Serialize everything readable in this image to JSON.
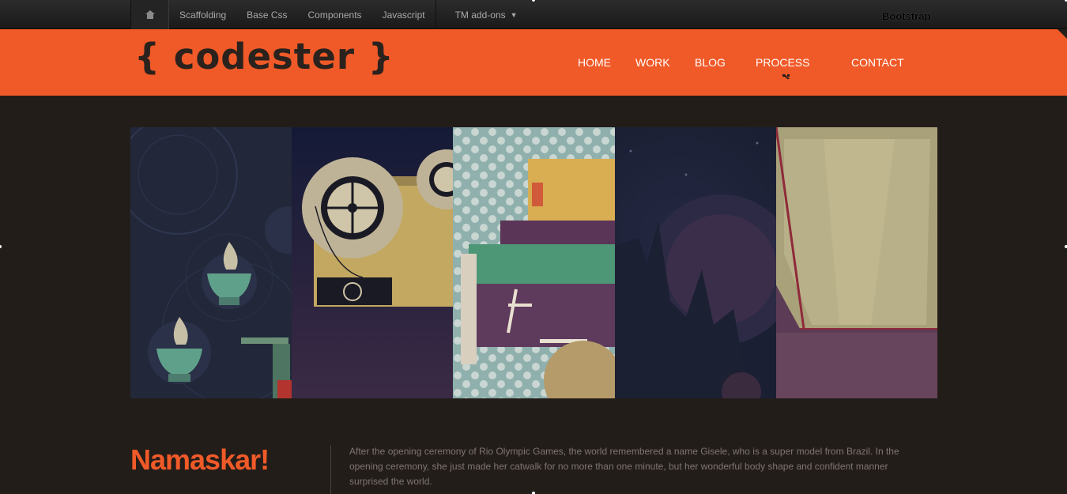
{
  "topbar": {
    "home_icon": "home-icon",
    "links": [
      "Scaffolding",
      "Base Css",
      "Components",
      "Javascript"
    ],
    "dropdown_label": "TM add-ons",
    "dropdown_caret": "▼",
    "brand": "Bootstrap"
  },
  "header": {
    "logo": "{ codester }",
    "nav": [
      "HOME",
      "WORK",
      "BLOG",
      "PROCESS",
      "CONTACT"
    ],
    "accent": "#f05a28"
  },
  "hero": {
    "panels": [
      "illustration-panel-1",
      "illustration-panel-2",
      "illustration-panel-3",
      "illustration-panel-4",
      "illustration-panel-5"
    ]
  },
  "content": {
    "greeting": "Namaskar!",
    "intro": "After the opening ceremony of Rio Olympic Games, the world remembered a name Gisele, who is a super model from Brazil. In the opening ceremony, she just made her catwalk for no more than one minute, but her wonderful body shape and confident manner surprised the world."
  }
}
